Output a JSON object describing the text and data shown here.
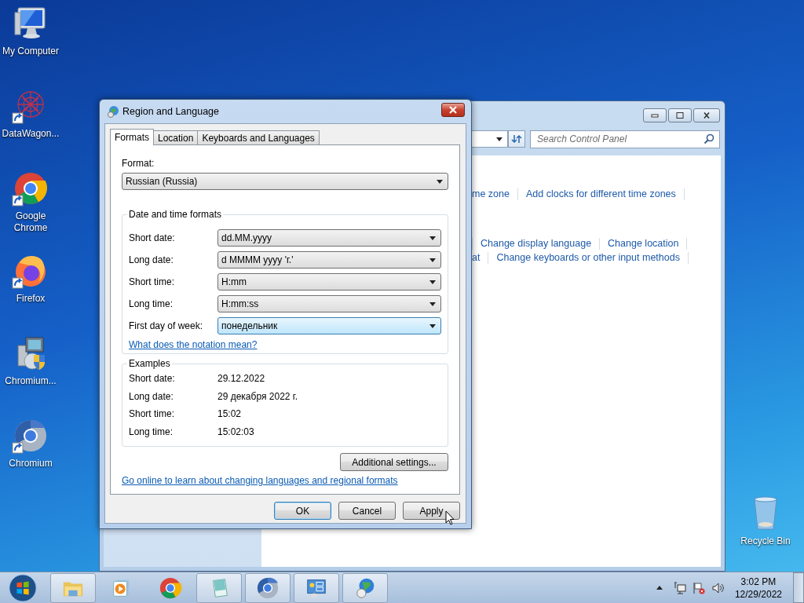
{
  "desktop_icons": [
    {
      "kind": "computer",
      "label": "My Computer",
      "shortcut": false
    },
    {
      "kind": "datawagon",
      "label": "DataWagon...",
      "shortcut": true
    },
    {
      "kind": "chrome",
      "label": "Google Chrome",
      "shortcut": true
    },
    {
      "kind": "firefox",
      "label": "Firefox",
      "shortcut": true
    },
    {
      "kind": "installer",
      "label": "Chromium...",
      "shortcut": false
    },
    {
      "kind": "chromium",
      "label": "Chromium",
      "shortcut": true
    }
  ],
  "recycle_bin": {
    "label": "Recycle Bin"
  },
  "control_panel": {
    "search": {
      "placeholder": "Search Control Panel"
    },
    "link_rows": [
      {
        "links": [
          "me zone",
          "Add clocks for different time zones"
        ]
      },
      {
        "links": [
          "Change display language",
          "Change location"
        ]
      },
      {
        "links": [
          "at",
          "Change keyboards or other input methods"
        ]
      }
    ]
  },
  "dialog": {
    "title": "Region and Language",
    "tabs": [
      {
        "label": "Formats",
        "selected": true
      },
      {
        "label": "Location",
        "selected": false
      },
      {
        "label": "Keyboards and Languages",
        "selected": false
      }
    ],
    "format_label": "Format:",
    "format_value": "Russian (Russia)",
    "formats_group": "Date and time formats",
    "fields": [
      {
        "label": "Short date:",
        "value": "dd.MM.yyyy",
        "focused": false
      },
      {
        "label": "Long date:",
        "value": "d MMMM yyyy 'г.'",
        "focused": false
      },
      {
        "label": "Short time:",
        "value": "H:mm",
        "focused": false
      },
      {
        "label": "Long time:",
        "value": "H:mm:ss",
        "focused": false
      },
      {
        "label": "First day of week:",
        "value": "понедельник",
        "focused": true
      }
    ],
    "notation_link": "What does the notation mean?",
    "examples_group": "Examples",
    "examples": [
      {
        "label": "Short date:",
        "value": "29.12.2022"
      },
      {
        "label": "Long date:",
        "value": "29 декабря 2022 г."
      },
      {
        "label": "Short time:",
        "value": "15:02"
      },
      {
        "label": "Long time:",
        "value": "15:02:03"
      }
    ],
    "additional_button": "Additional settings...",
    "online_link": "Go online to learn about changing languages and regional formats",
    "buttons": [
      {
        "label": "OK",
        "default": true
      },
      {
        "label": "Cancel",
        "default": false
      },
      {
        "label": "Apply",
        "default": false
      }
    ]
  },
  "taskbar": {
    "items": [
      {
        "kind": "explorer",
        "running": true
      },
      {
        "kind": "media",
        "running": false
      },
      {
        "kind": "chrome",
        "running": false
      },
      {
        "kind": "notepad",
        "running": true
      },
      {
        "kind": "chromium",
        "running": true
      },
      {
        "kind": "control",
        "running": true
      },
      {
        "kind": "globe",
        "running": true
      }
    ],
    "clock": {
      "time": "3:02 PM",
      "date": "12/29/2022"
    }
  }
}
